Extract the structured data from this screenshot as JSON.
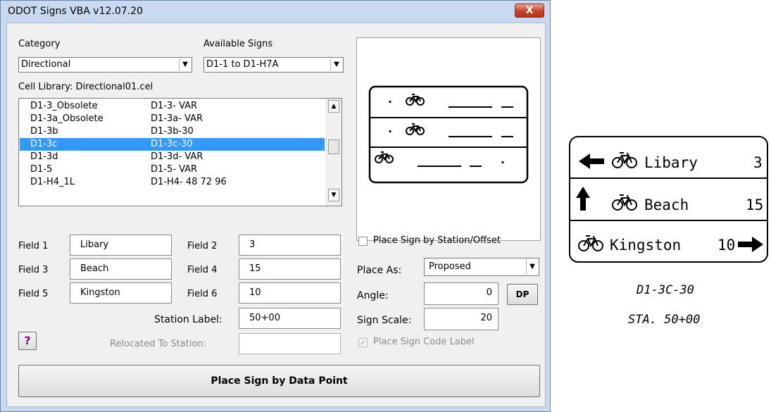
{
  "window": {
    "title": "ODOT Signs VBA  v12.07.20",
    "close_glyph": "X"
  },
  "category": {
    "label": "Category",
    "value": "Directional"
  },
  "available_signs": {
    "label": "Available Signs",
    "value": "D1-1 to D1-H7A"
  },
  "cell_library": "Cell Library:  Directional01.cel",
  "sign_list": {
    "rows": [
      {
        "code": "D1-3_Obsolete",
        "cell": "D1-3- VAR"
      },
      {
        "code": "D1-3a_Obsolete",
        "cell": "D1-3a- VAR"
      },
      {
        "code": "D1-3b",
        "cell": "D1-3b-30"
      },
      {
        "code": "D1-3c",
        "cell": "D1-3c-30"
      },
      {
        "code": "D1-3d",
        "cell": "D1-3d- VAR"
      },
      {
        "code": "D1-5",
        "cell": "D1-5- VAR"
      },
      {
        "code": "D1-H4_1L",
        "cell": "D1-H4- 48 72 96"
      }
    ],
    "selected_index": 3
  },
  "fields": {
    "f1_label": "Field 1",
    "f1_value": "Libary",
    "f2_label": "Field 2",
    "f2_value": "3",
    "f3_label": "Field 3",
    "f3_value": "Beach",
    "f4_label": "Field 4",
    "f4_value": "15",
    "f5_label": "Field 5",
    "f5_value": "Kingston",
    "f6_label": "Field 6",
    "f6_value": "10"
  },
  "station_label": {
    "label": "Station Label:",
    "value": "50+00"
  },
  "relocated": {
    "label": "Relocated To Station:",
    "value": ""
  },
  "help_button": "?",
  "place_by_station": {
    "label": "Place Sign by Station/Offset",
    "checked": false
  },
  "place_as": {
    "label": "Place As:",
    "value": "Proposed"
  },
  "angle": {
    "label": "Angle:",
    "value": "0"
  },
  "dp_button": "DP",
  "sign_scale": {
    "label": "Sign Scale:",
    "value": "20"
  },
  "place_code_label": {
    "label": "Place Sign Code Label",
    "checked": true,
    "enabled": false
  },
  "place_button": "Place Sign by Data Point",
  "preview": {
    "row1": {
      "prefix": "·"
    },
    "row2": {
      "prefix": "·"
    },
    "row3": {
      "suffix": "·"
    }
  },
  "drawing": {
    "row1": {
      "destination": "Libary",
      "distance": "3"
    },
    "row2": {
      "destination": "Beach",
      "distance": "15"
    },
    "row3": {
      "destination": "Kingston",
      "distance": "10"
    },
    "sign_code": "D1-3C-30",
    "station": "STA. 50+00"
  },
  "colors": {
    "selection": "#3399ff",
    "help_glyph": "#800080",
    "close_red": "#c8432c"
  }
}
